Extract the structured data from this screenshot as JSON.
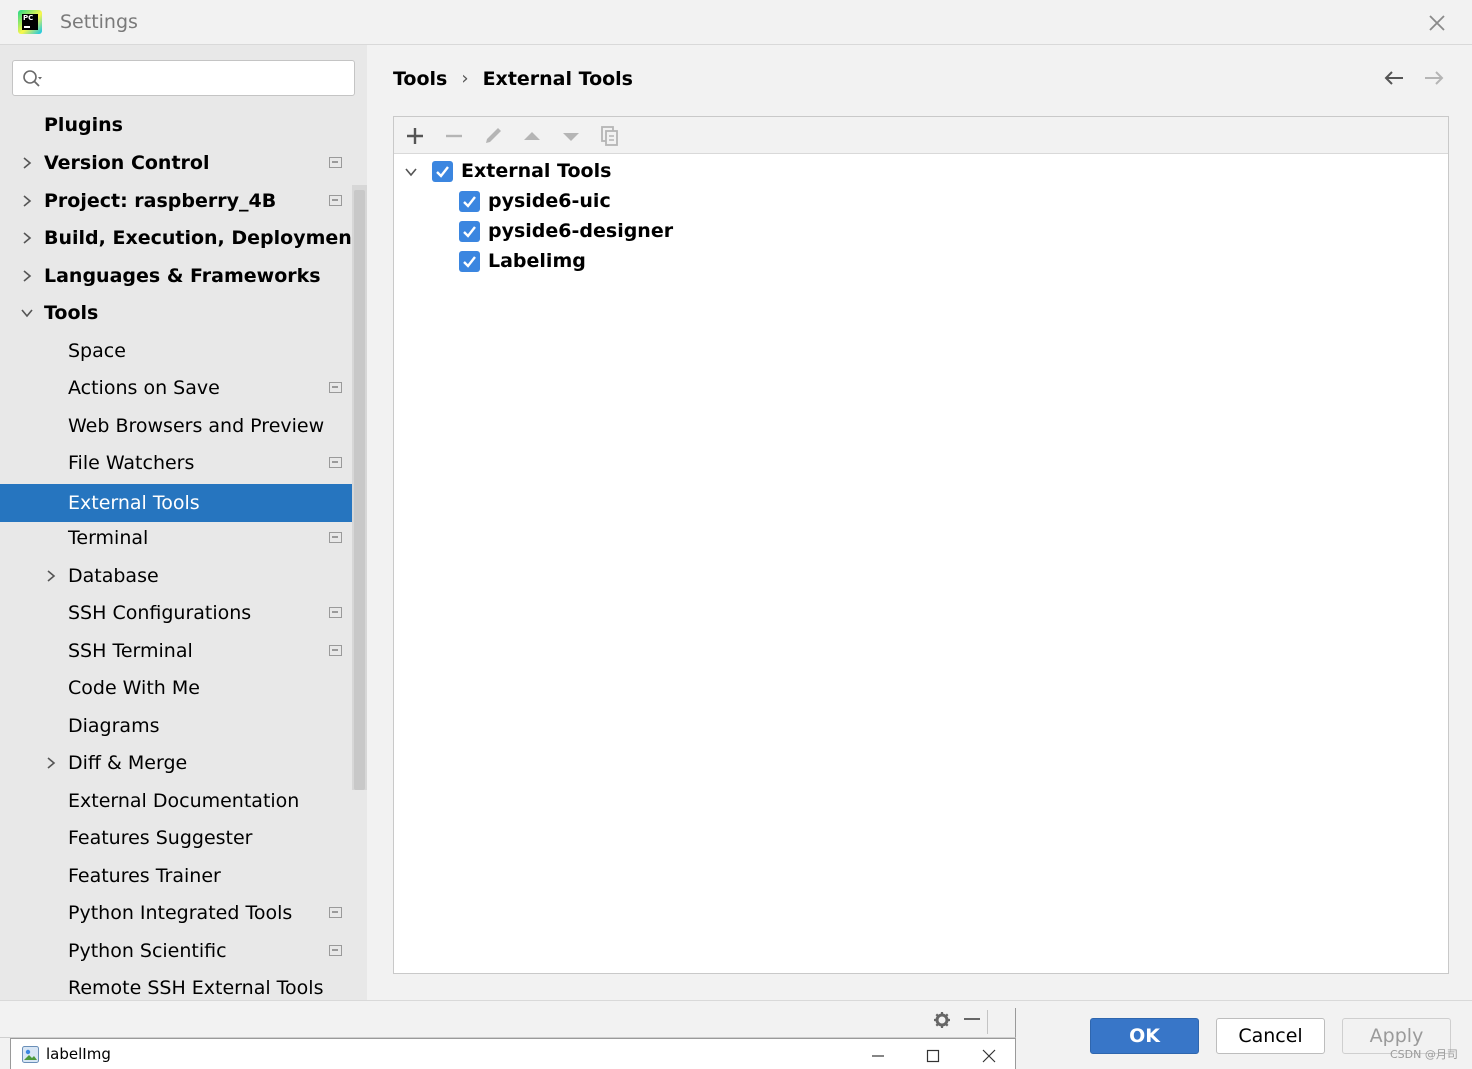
{
  "window": {
    "title": "Settings"
  },
  "search": {
    "value": "",
    "placeholder": ""
  },
  "sidebar": {
    "items": [
      {
        "label": "Plugins"
      },
      {
        "label": "Version Control"
      },
      {
        "label": "Project: raspberry_4B"
      },
      {
        "label": "Build, Execution, Deployment"
      },
      {
        "label": "Languages & Frameworks"
      },
      {
        "label": "Tools"
      },
      {
        "label": "Space"
      },
      {
        "label": "Actions on Save"
      },
      {
        "label": "Web Browsers and Preview"
      },
      {
        "label": "File Watchers"
      },
      {
        "label": "External Tools"
      },
      {
        "label": "Terminal"
      },
      {
        "label": "Database"
      },
      {
        "label": "SSH Configurations"
      },
      {
        "label": "SSH Terminal"
      },
      {
        "label": "Code With Me"
      },
      {
        "label": "Diagrams"
      },
      {
        "label": "Diff & Merge"
      },
      {
        "label": "External Documentation"
      },
      {
        "label": "Features Suggester"
      },
      {
        "label": "Features Trainer"
      },
      {
        "label": "Python Integrated Tools"
      },
      {
        "label": "Python Scientific"
      },
      {
        "label": "Remote SSH External Tools"
      }
    ],
    "selected": "External Tools"
  },
  "breadcrumb": {
    "parent": "Tools",
    "separator": "›",
    "current": "External Tools"
  },
  "tree": {
    "group": {
      "label": "External Tools",
      "checked": true,
      "expanded": true
    },
    "tools": [
      {
        "label": "pyside6-uic",
        "checked": true
      },
      {
        "label": "pyside6-designer",
        "checked": true
      },
      {
        "label": "Labelimg",
        "checked": true
      }
    ]
  },
  "buttons": {
    "ok": "OK",
    "cancel": "Cancel",
    "apply": "Apply"
  },
  "colors": {
    "accent": "#2675bf",
    "ok_button": "#3876c8",
    "checkbox": "#3b86e0"
  },
  "labelimg_window": {
    "title": "labelImg"
  },
  "watermark": "CSDN @月司"
}
